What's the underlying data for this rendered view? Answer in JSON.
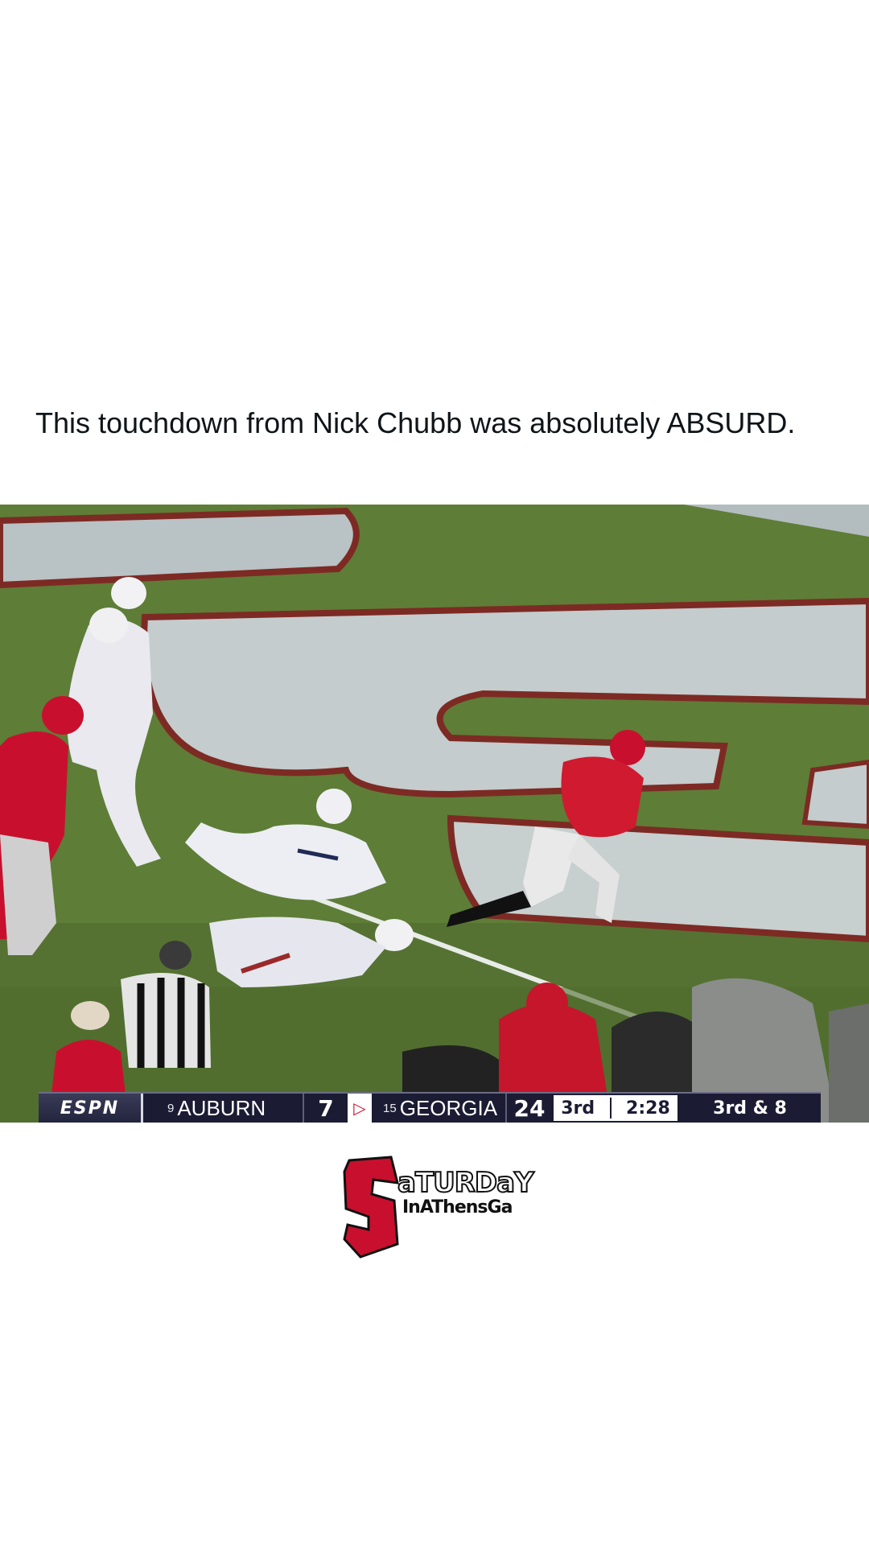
{
  "post": {
    "caption": "This touchdown from Nick Chubb was absolutely ABSURD."
  },
  "video": {
    "scorebug": {
      "network": "ESPN",
      "away_rank": "9",
      "away_team": "AUBURN",
      "away_score": "7",
      "possession_arrow": "▷",
      "home_rank": "15",
      "home_team": "GEORGIA",
      "home_score": "24",
      "quarter": "3rd",
      "clock": "2:28",
      "down_distance": "3rd & 8"
    }
  },
  "logo": {
    "big_letter": "S",
    "line1": "aTURDaY",
    "line2": "InAThensGa",
    "colors": {
      "red": "#c8102e",
      "black": "#111111"
    }
  }
}
